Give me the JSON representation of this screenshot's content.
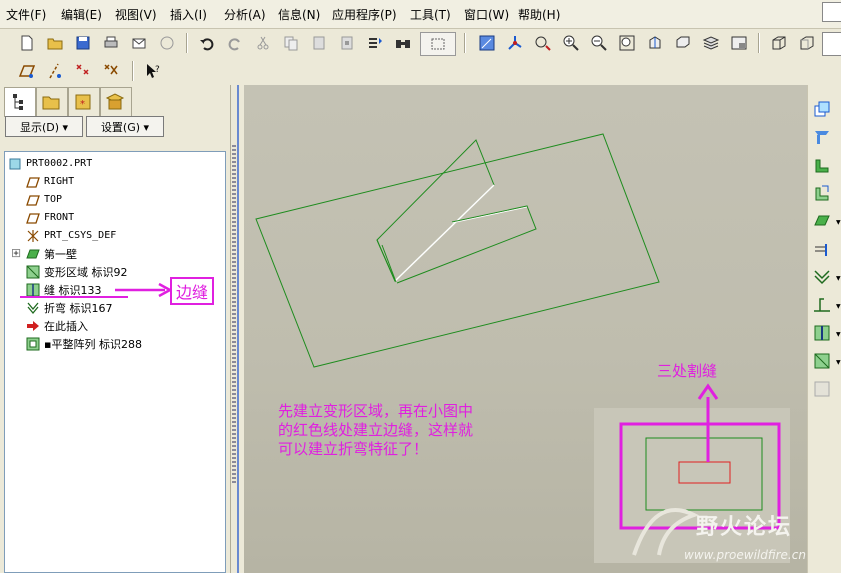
{
  "menu": [
    {
      "label": "文件(F)"
    },
    {
      "label": "编辑(E)"
    },
    {
      "label": "视图(V)"
    },
    {
      "label": "插入(I)"
    },
    {
      "label": "分析(A)"
    },
    {
      "label": "信息(N)"
    },
    {
      "label": "应用程序(P)"
    },
    {
      "label": "工具(T)"
    },
    {
      "label": "窗口(W)"
    },
    {
      "label": "帮助(H)"
    }
  ],
  "panel": {
    "display_button": "显示(D) ▾",
    "settings_button": "设置(G) ▾"
  },
  "tree": {
    "items": [
      {
        "label": "PRT0002.PRT",
        "icon": "part-icon"
      },
      {
        "label": "RIGHT",
        "icon": "datum-plane-icon"
      },
      {
        "label": "TOP",
        "icon": "datum-plane-icon"
      },
      {
        "label": "FRONT",
        "icon": "datum-plane-icon"
      },
      {
        "label": "PRT_CSYS_DEF",
        "icon": "csys-icon"
      },
      {
        "label": "第一壁",
        "icon": "wall-icon"
      },
      {
        "label": "变形区域  标识92",
        "icon": "deform-area-icon"
      },
      {
        "label": "缝  标识133",
        "icon": "rip-icon"
      },
      {
        "label": "折弯  标识167",
        "icon": "bend-icon"
      },
      {
        "label": "在此插入",
        "icon": "insert-here-icon"
      },
      {
        "label": "▪平整阵列  标识288",
        "icon": "flat-pattern-icon"
      }
    ]
  },
  "annotations": {
    "edge_rip": "边缝",
    "three_rips": "三处割缝",
    "note_line1": "先建立变形区域，再在小图中",
    "note_line2": "的红色线处建立边缝，这样就",
    "note_line3": "可以建立折弯特征了！"
  },
  "watermark": {
    "title": "野火论坛",
    "url": "www.proewildfire.cn"
  },
  "colors": {
    "annotation": "#e020e0",
    "model_edge": "#1e8c1e",
    "rip_line": "#e02020"
  }
}
